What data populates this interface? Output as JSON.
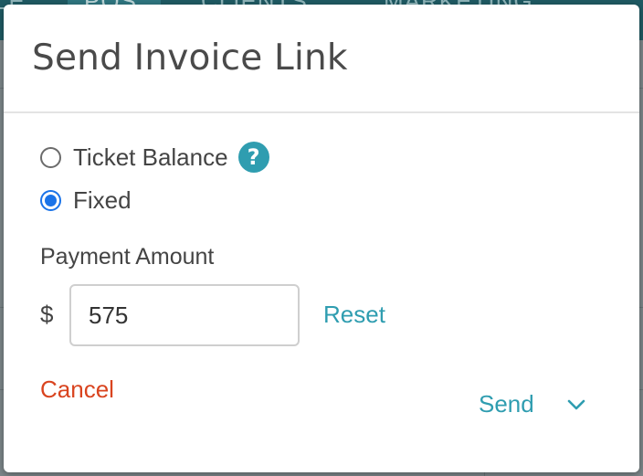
{
  "app_header": {
    "nav_items": [
      "LE",
      "POS",
      "CLIENTS",
      "MARKETING"
    ]
  },
  "modal": {
    "title": "Send Invoice Link",
    "options": [
      {
        "label": "Ticket Balance",
        "selected": false,
        "help_icon": "question-mark-icon"
      },
      {
        "label": "Fixed",
        "selected": true
      }
    ],
    "payment_amount": {
      "label": "Payment Amount",
      "currency_symbol": "$",
      "value": "575",
      "reset_label": "Reset"
    },
    "cancel_label": "Cancel",
    "send_label": "Send",
    "send_menu_icon": "chevron-down-icon"
  },
  "colors": {
    "accent": "#2f9db0",
    "radio_selected": "#1a73e8",
    "cancel": "#d9441f",
    "header_bg": "#1f5a63"
  }
}
